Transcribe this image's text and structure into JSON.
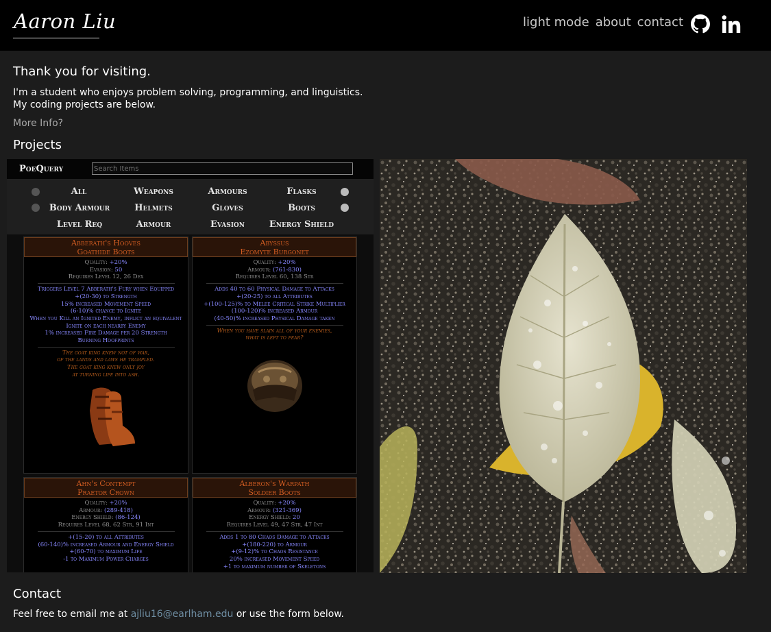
{
  "header": {
    "logo": "Aaron Liu",
    "nav": [
      "light mode",
      "about",
      "contact"
    ],
    "icons": [
      "github-icon",
      "linkedin-icon"
    ]
  },
  "intro": {
    "heading": "Thank you for visiting.",
    "line1": "I'm a student who enjoys problem solving, programming, and linguistics.",
    "line2": "My coding projects are below.",
    "more": "More Info?"
  },
  "projects": {
    "heading": "Projects",
    "poe": {
      "brand": "PoeQuery",
      "search_placeholder": "Search Items",
      "filters_row1": [
        "All",
        "Weapons",
        "Armours",
        "Flasks"
      ],
      "filters_row2": [
        "Body Armour",
        "Helmets",
        "Gloves",
        "Boots"
      ],
      "filters_row3": [
        "Level Req",
        "Armour",
        "Evasion",
        "Energy Shield"
      ],
      "cards": [
        {
          "name": "Abberath's Hooves",
          "base": "Goathide Boots",
          "props": [
            [
              "Quality: ",
              "+20%"
            ],
            [
              "Evasion: ",
              "50"
            ]
          ],
          "req": "Requires Level 12, 26 Dex",
          "mods": [
            "Triggers Level 7 Abberath's Fury when Equipped",
            "+(20-30) to Strength",
            "15% increased Movement Speed",
            "(6-10)% chance to Ignite",
            "When you Kill an Ignited Enemy, inflict an equivalent Ignite on each nearby Enemy",
            "1% increased Fire Damage per 20 Strength",
            "Burning Hoofprints"
          ],
          "flavour": [
            "The goat king knew not of war,",
            "of the lands and laws he trampled.",
            "The goat king knew only joy",
            "at turning life into ash."
          ]
        },
        {
          "name": "Abyssus",
          "base": "Ezomyte Burgonet",
          "props": [
            [
              "Quality: ",
              "+20%"
            ],
            [
              "Armour: ",
              "(761-830)"
            ]
          ],
          "req": "Requires Level 60, 138 Str",
          "mods": [
            "Adds 40 to 60 Physical Damage to Attacks",
            "+(20-25) to all Attributes",
            "+(100-125)% to Melee Critical Strike Multiplier",
            "(100-120)% increased Armour",
            "(40-50)% increased Physical Damage taken"
          ],
          "flavour": [
            "When you have slain all of your enemies,",
            "what is left to fear?"
          ]
        },
        {
          "name": "Ahn's Contempt",
          "base": "Praetor Crown",
          "props": [
            [
              "Quality: ",
              "+20%"
            ],
            [
              "Armour: ",
              "(289-418)"
            ],
            [
              "Energy Shield: ",
              "(86-124)"
            ]
          ],
          "req": "Requires Level 68, 62 Str, 91 Int",
          "mods": [
            "+(15-20) to all Attributes",
            "(60-140)% increased Armour and Energy Shield",
            "+(60-70) to maximum Life",
            "-1 to Maximum Power Charges"
          ],
          "flavour": []
        },
        {
          "name": "Alberon's Warpath",
          "base": "Soldier Boots",
          "props": [
            [
              "Quality: ",
              "+20%"
            ],
            [
              "Armour: ",
              "(321-369)"
            ],
            [
              "Energy Shield: ",
              "20"
            ]
          ],
          "req": "Requires Level 49, 47 Str, 47 Int",
          "mods": [
            "Adds 1 to 80 Chaos Damage to Attacks",
            "+(180-220) to Armour",
            "+(9-12)% to Chaos Resistance",
            "20% increased Movement Speed",
            "+1 to maximum number of Skeletons"
          ],
          "flavour": []
        }
      ]
    }
  },
  "contact": {
    "heading": "Contact",
    "text_before": "Feel free to email me at ",
    "email": "ajliu16@earlham.edu",
    "text_after": " or use the form below."
  },
  "colors": {
    "background": "#1c1c1c",
    "header": "#000000",
    "link": "#6f8ea3",
    "unique_item": "#d35d22",
    "magic_mod": "#8888ff"
  }
}
